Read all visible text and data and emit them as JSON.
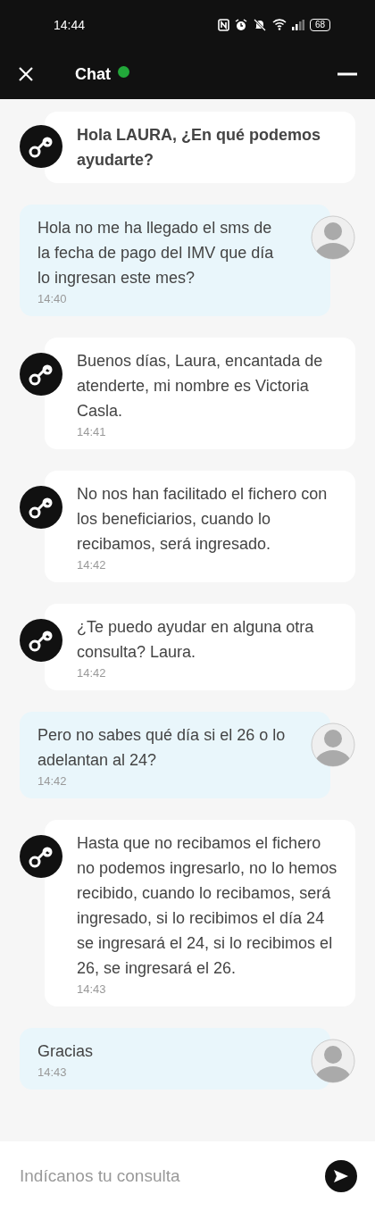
{
  "status_bar": {
    "time": "14:44",
    "battery": "68"
  },
  "header": {
    "title": "Chat",
    "online": true
  },
  "messages": [
    {
      "kind": "agent",
      "text": "Hola LAURA, ¿En qué podemos ayudarte?",
      "bold": true
    },
    {
      "kind": "user",
      "text": "Hola no me ha llegado el sms de la fecha de pago del IMV que día lo ingresan este mes?",
      "time": "14:40"
    },
    {
      "kind": "agent",
      "text": "Buenos días, Laura, encantada de atenderte, mi nombre es Victoria Casla.",
      "time": "14:41"
    },
    {
      "kind": "agent",
      "text": "No nos han facilitado el fichero con los beneficiarios, cuando lo recibamos, será ingresado.",
      "time": "14:42"
    },
    {
      "kind": "agent",
      "text": "¿Te puedo ayudar en alguna otra consulta? Laura.",
      "time": "14:42"
    },
    {
      "kind": "user",
      "text": "Pero no sabes qué día si el 26 o lo adelantan al 24?",
      "time": "14:42"
    },
    {
      "kind": "agent",
      "text": "Hasta que no recibamos el fichero no podemos ingresarlo, no lo hemos recibido, cuando lo recibamos, será ingresado, si lo recibimos el día 24 se ingresará el 24, si lo recibimos el 26, se ingresará el 26.",
      "time": "14:43"
    },
    {
      "kind": "user",
      "text": "Gracias",
      "time": "14:43"
    }
  ],
  "composer": {
    "placeholder": "Indícanos tu consulta"
  }
}
